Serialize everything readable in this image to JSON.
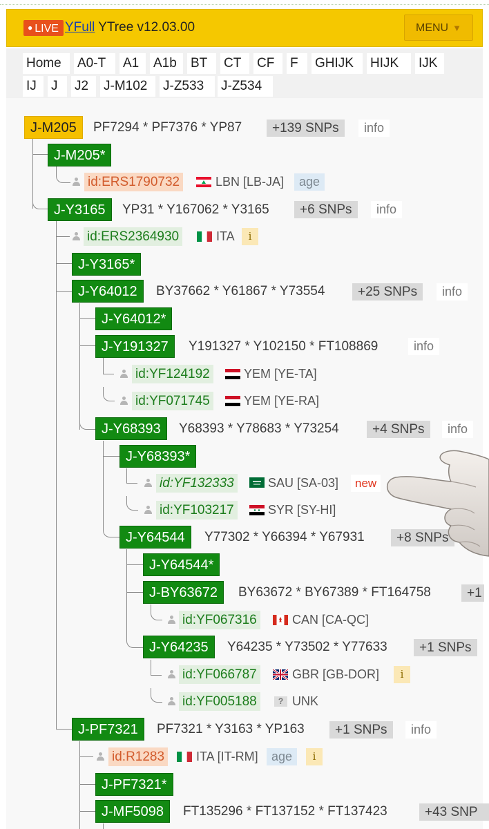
{
  "header": {
    "live_label": "LIVE",
    "brand_link": "YFull",
    "title": "YTree v12.03.00",
    "menu_label": "MENU",
    "menu_icon": "caret-down-icon",
    "colors": {
      "bar": "#f5c800",
      "live": "#e8501b",
      "menu": "#f0bb00"
    }
  },
  "breadcrumbs": [
    "Home",
    "A0-T",
    "A1",
    "A1b",
    "BT",
    "CT",
    "CF",
    "F",
    "GHIJK",
    "HIJK",
    "IJK",
    "IJ",
    "J",
    "J2",
    "J-M102",
    "J-Z533",
    "J-Z534"
  ],
  "tree": {
    "colors": {
      "clade": "#128a12",
      "current_clade": "#f5c000",
      "sample_green": "#e2efe0",
      "sample_orange": "#fad9c3"
    },
    "root": {
      "label": "J-M205",
      "snps": "PF7294 * PF7376 * YP87",
      "count": "+139 SNPs",
      "info": "info"
    },
    "nodes": [
      {
        "label": "J-M205*"
      },
      {
        "label": "J-Y3165",
        "snps": "YP31 * Y167062 * Y3165",
        "count": "+6 SNPs",
        "info": "info"
      },
      {
        "label": "J-Y3165*"
      },
      {
        "label": "J-Y64012",
        "snps": "BY37662 * Y61867 * Y73554",
        "count": "+25 SNPs",
        "info": "info"
      },
      {
        "label": "J-Y64012*"
      },
      {
        "label": "J-Y191327",
        "snps": "Y191327 * Y102150 * FT108869",
        "info": "info"
      },
      {
        "label": "J-Y68393",
        "snps": "Y68393 * Y78683 * Y73254",
        "count": "+4 SNPs",
        "info": "info"
      },
      {
        "label": "J-Y68393*"
      },
      {
        "label": "J-Y64544",
        "snps": "Y77302 * Y66394 * Y67931",
        "count": "+8 SNPs"
      },
      {
        "label": "J-Y64544*"
      },
      {
        "label": "J-BY63672",
        "snps": "BY63672 * BY67389 * FT164758",
        "count": "+1"
      },
      {
        "label": "J-Y64235",
        "snps": "Y64235 * Y73502 * Y77633",
        "count": "+1 SNPs"
      },
      {
        "label": "J-PF7321",
        "snps": "PF7321 * Y3163 * YP163",
        "count": "+1 SNPs",
        "info": "info"
      },
      {
        "label": "J-PF7321*"
      },
      {
        "label": "J-MF5098",
        "snps": "FT135296 * FT137152 * FT137423",
        "count": "+43 SNP"
      }
    ],
    "samples": [
      {
        "id": "id:ERS1790732",
        "country": "LBN [LB-JA]",
        "flag": "lebanon",
        "age": "age"
      },
      {
        "id": "id:ERS2364930",
        "country": "ITA",
        "flag": "italy",
        "badge": "i"
      },
      {
        "id": "id:YF124192",
        "country": "YEM [YE-TA]",
        "flag": "yemen"
      },
      {
        "id": "id:YF071745",
        "country": "YEM [YE-RA]",
        "flag": "yemen"
      },
      {
        "id": "id:YF132333",
        "country": "SAU [SA-03]",
        "flag": "saudi",
        "new": "new"
      },
      {
        "id": "id:YF103217",
        "country": "SYR [SY-HI]",
        "flag": "syria"
      },
      {
        "id": "id:YF067316",
        "country": "CAN [CA-QC]",
        "flag": "canada"
      },
      {
        "id": "id:YF066787",
        "country": "GBR [GB-DOR]",
        "flag": "uk",
        "badge": "i"
      },
      {
        "id": "id:YF005188",
        "country": "UNK",
        "flag": "unknown",
        "flag_text": "?"
      },
      {
        "id": "id:R1283",
        "country": "ITA [IT-RM]",
        "flag": "italy",
        "age": "age",
        "badge": "i"
      }
    ]
  }
}
